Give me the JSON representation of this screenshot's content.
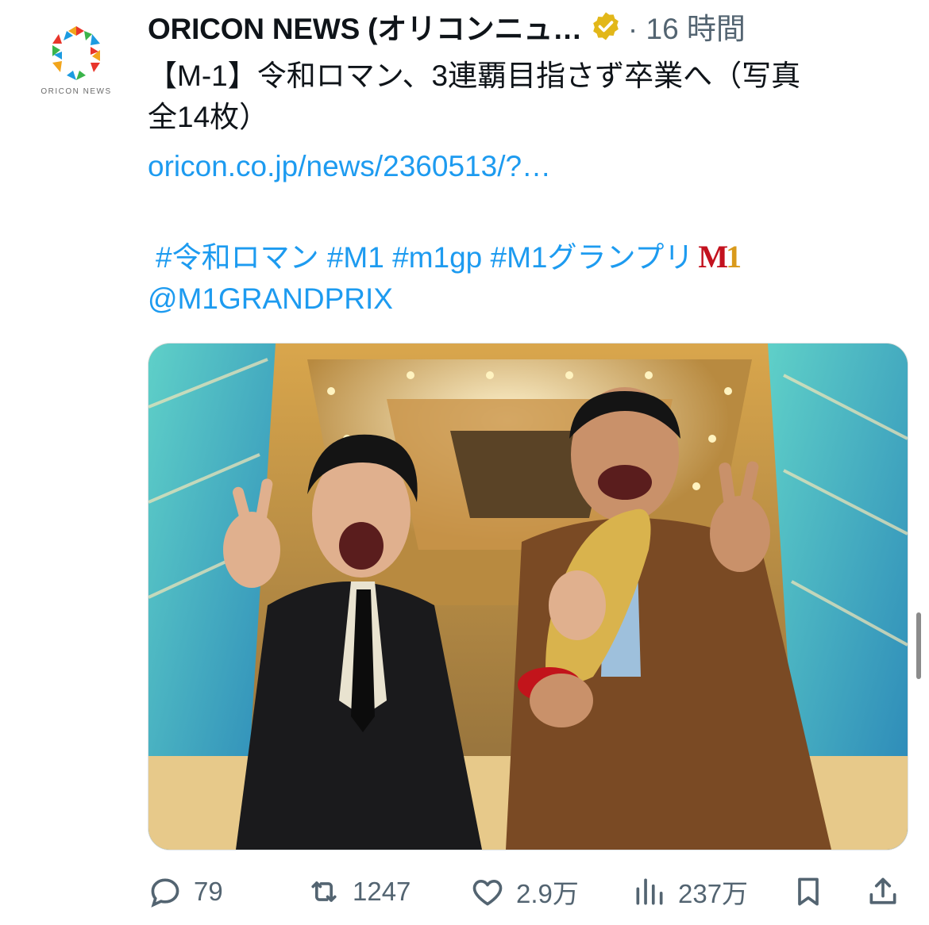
{
  "account": {
    "name": "ORICON NEWS (オリコンニュ…",
    "meta": "· 16 時間",
    "avatar_caption": "ORICON NEWS"
  },
  "tweet": {
    "line1": "【M-1】令和ロマン、3連覇目指さず卒業へ（写真",
    "line2": "全14枚）",
    "link": "oricon.co.jp/news/2360513/?…",
    "hashtags": "#令和ロマン #M1 #m1gp #M1グランプリ",
    "mention": "@M1GRANDPRIX",
    "badge_m": "M",
    "badge_1": "1"
  },
  "actions": {
    "reply_count": "79",
    "retweet_count": "1247",
    "like_count": "2.9万",
    "views_count": "237万"
  },
  "colors": {
    "link": "#1d9bf0",
    "secondary_text": "#536471",
    "verified_gold": "#e2b719"
  }
}
